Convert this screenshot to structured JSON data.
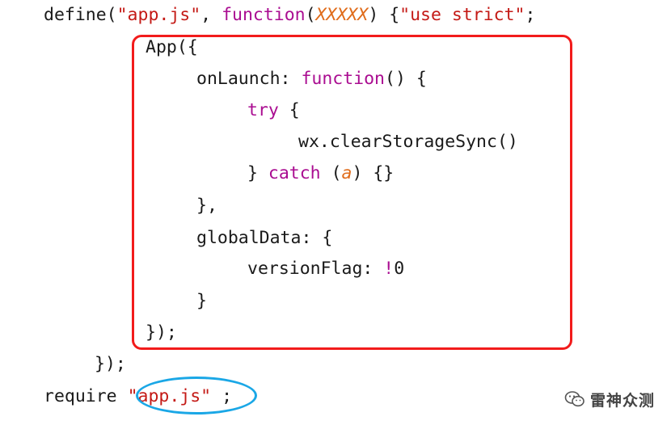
{
  "colors": {
    "plain": "#1a1a1a",
    "string": "#c41a16",
    "keyword": "#aa0d91",
    "param": "#e06c1b",
    "box_outline": "#f21b1b",
    "oval_outline": "#1aa7e6"
  },
  "code": {
    "l1": {
      "t1": "define(",
      "t2": "\"app.js\"",
      "t3": ", ",
      "t4": "function",
      "t5": "(",
      "t6": "XXXXX",
      "t7": ") {",
      "t8": "\"use strict\"",
      "t9": ";"
    },
    "l2": {
      "t1": "App({"
    },
    "l3": {
      "t1": "onLaunch: ",
      "t2": "function",
      "t3": "() {"
    },
    "l4": {
      "t1": "try",
      "t2": " {"
    },
    "l5": {
      "t1": "wx.clearStorageSync()"
    },
    "l6": {
      "t1": "} ",
      "t2": "catch",
      "t3": " (",
      "t4": "a",
      "t5": ") {}"
    },
    "l7": {
      "t1": "},"
    },
    "l8": {
      "t1": "globalData: {"
    },
    "l9": {
      "t1": "versionFlag: ",
      "t2": "!",
      "t3": "0"
    },
    "l10": {
      "t1": "}"
    },
    "l11": {
      "t1": "});"
    },
    "l12": {
      "t1": "});"
    },
    "l13": {
      "t1": "require ",
      "t2": "\"app.js\"",
      "t3": " ;"
    }
  },
  "watermark": {
    "icon": "wechat-icon",
    "text": "雷神众测"
  }
}
